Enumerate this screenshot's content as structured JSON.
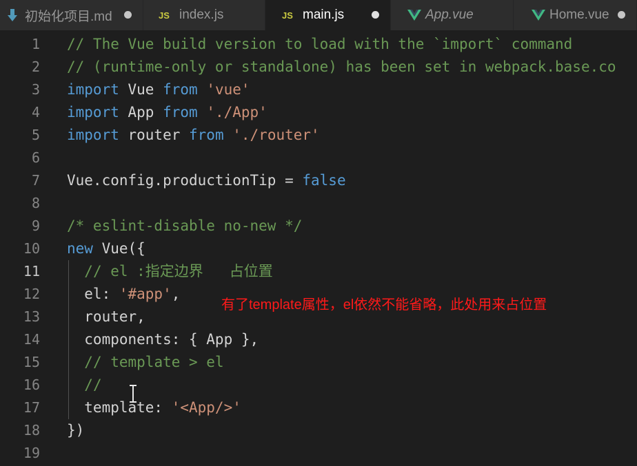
{
  "tabs": [
    {
      "label": "初始化项目.md",
      "icon": "markdown-icon",
      "dirty": true,
      "active": false
    },
    {
      "label": "index.js",
      "icon": "js-icon",
      "dirty": false,
      "active": false
    },
    {
      "label": "main.js",
      "icon": "js-icon",
      "dirty": true,
      "active": true
    },
    {
      "label": "App.vue",
      "icon": "vue-icon",
      "dirty": false,
      "active": false
    },
    {
      "label": "Home.vue",
      "icon": "vue-icon",
      "dirty": true,
      "active": false
    }
  ],
  "js_icon_text": "JS",
  "current_line": 11,
  "lines": [
    {
      "n": "1",
      "tokens": [
        [
          "com",
          "// The Vue build version to load with the `import` command"
        ]
      ]
    },
    {
      "n": "2",
      "tokens": [
        [
          "com",
          "// (runtime-only or standalone) has been set in webpack.base.co"
        ]
      ]
    },
    {
      "n": "3",
      "tokens": [
        [
          "kw",
          "import"
        ],
        [
          "def",
          " Vue "
        ],
        [
          "kw",
          "from"
        ],
        [
          "def",
          " "
        ],
        [
          "str",
          "'vue'"
        ]
      ]
    },
    {
      "n": "4",
      "tokens": [
        [
          "kw",
          "import"
        ],
        [
          "def",
          " App "
        ],
        [
          "kw",
          "from"
        ],
        [
          "def",
          " "
        ],
        [
          "str",
          "'./App'"
        ]
      ]
    },
    {
      "n": "5",
      "tokens": [
        [
          "kw",
          "import"
        ],
        [
          "def",
          " router "
        ],
        [
          "kw",
          "from"
        ],
        [
          "def",
          " "
        ],
        [
          "str",
          "'./router'"
        ]
      ]
    },
    {
      "n": "6",
      "tokens": []
    },
    {
      "n": "7",
      "tokens": [
        [
          "def",
          "Vue.config.productionTip = "
        ],
        [
          "kw",
          "false"
        ]
      ]
    },
    {
      "n": "8",
      "tokens": []
    },
    {
      "n": "9",
      "tokens": [
        [
          "com",
          "/* eslint-disable no-new */"
        ]
      ]
    },
    {
      "n": "10",
      "tokens": [
        [
          "kw",
          "new"
        ],
        [
          "def",
          " Vue({"
        ]
      ]
    },
    {
      "n": "11",
      "tokens": [
        [
          "def",
          "  "
        ],
        [
          "com",
          "// el :指定边界   占位置"
        ]
      ]
    },
    {
      "n": "12",
      "tokens": [
        [
          "def",
          "  el: "
        ],
        [
          "str",
          "'#app'"
        ],
        [
          "def",
          ","
        ]
      ]
    },
    {
      "n": "13",
      "tokens": [
        [
          "def",
          "  router,"
        ]
      ]
    },
    {
      "n": "14",
      "tokens": [
        [
          "def",
          "  components: { App },"
        ]
      ]
    },
    {
      "n": "15",
      "tokens": [
        [
          "def",
          "  "
        ],
        [
          "com",
          "// template > el"
        ]
      ]
    },
    {
      "n": "16",
      "tokens": [
        [
          "def",
          "  "
        ],
        [
          "com",
          "//"
        ]
      ]
    },
    {
      "n": "17",
      "tokens": [
        [
          "def",
          "  template: "
        ],
        [
          "str",
          "'<App/>'"
        ]
      ]
    },
    {
      "n": "18",
      "tokens": [
        [
          "def",
          "})"
        ]
      ]
    },
    {
      "n": "19",
      "tokens": []
    }
  ],
  "annotation": "有了template属性，el依然不能省略，此处用来占位置",
  "colors": {
    "background": "#1e1e1e",
    "comment": "#6a9955",
    "keyword": "#569cd6",
    "string": "#ce9178",
    "annotation": "#ff1a1a"
  }
}
